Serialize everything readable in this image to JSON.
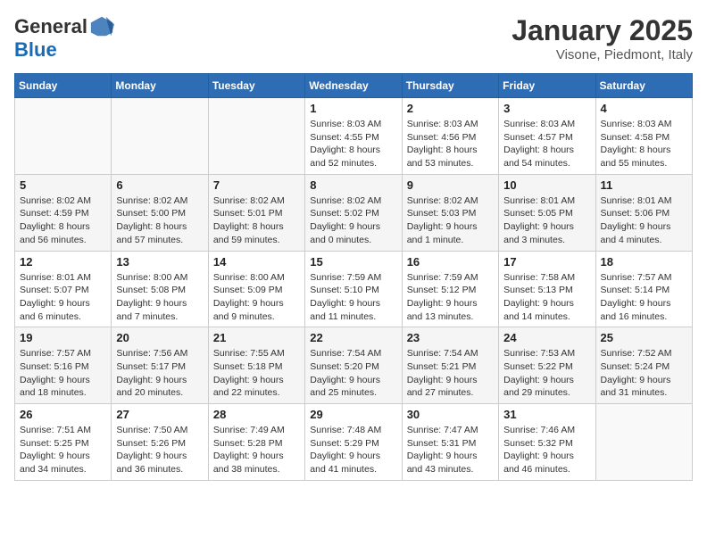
{
  "logo": {
    "general": "General",
    "blue": "Blue"
  },
  "title": "January 2025",
  "subtitle": "Visone, Piedmont, Italy",
  "days_header": [
    "Sunday",
    "Monday",
    "Tuesday",
    "Wednesday",
    "Thursday",
    "Friday",
    "Saturday"
  ],
  "weeks": [
    [
      {
        "day": "",
        "info": ""
      },
      {
        "day": "",
        "info": ""
      },
      {
        "day": "",
        "info": ""
      },
      {
        "day": "1",
        "info": "Sunrise: 8:03 AM\nSunset: 4:55 PM\nDaylight: 8 hours and 52 minutes."
      },
      {
        "day": "2",
        "info": "Sunrise: 8:03 AM\nSunset: 4:56 PM\nDaylight: 8 hours and 53 minutes."
      },
      {
        "day": "3",
        "info": "Sunrise: 8:03 AM\nSunset: 4:57 PM\nDaylight: 8 hours and 54 minutes."
      },
      {
        "day": "4",
        "info": "Sunrise: 8:03 AM\nSunset: 4:58 PM\nDaylight: 8 hours and 55 minutes."
      }
    ],
    [
      {
        "day": "5",
        "info": "Sunrise: 8:02 AM\nSunset: 4:59 PM\nDaylight: 8 hours and 56 minutes."
      },
      {
        "day": "6",
        "info": "Sunrise: 8:02 AM\nSunset: 5:00 PM\nDaylight: 8 hours and 57 minutes."
      },
      {
        "day": "7",
        "info": "Sunrise: 8:02 AM\nSunset: 5:01 PM\nDaylight: 8 hours and 59 minutes."
      },
      {
        "day": "8",
        "info": "Sunrise: 8:02 AM\nSunset: 5:02 PM\nDaylight: 9 hours and 0 minutes."
      },
      {
        "day": "9",
        "info": "Sunrise: 8:02 AM\nSunset: 5:03 PM\nDaylight: 9 hours and 1 minute."
      },
      {
        "day": "10",
        "info": "Sunrise: 8:01 AM\nSunset: 5:05 PM\nDaylight: 9 hours and 3 minutes."
      },
      {
        "day": "11",
        "info": "Sunrise: 8:01 AM\nSunset: 5:06 PM\nDaylight: 9 hours and 4 minutes."
      }
    ],
    [
      {
        "day": "12",
        "info": "Sunrise: 8:01 AM\nSunset: 5:07 PM\nDaylight: 9 hours and 6 minutes."
      },
      {
        "day": "13",
        "info": "Sunrise: 8:00 AM\nSunset: 5:08 PM\nDaylight: 9 hours and 7 minutes."
      },
      {
        "day": "14",
        "info": "Sunrise: 8:00 AM\nSunset: 5:09 PM\nDaylight: 9 hours and 9 minutes."
      },
      {
        "day": "15",
        "info": "Sunrise: 7:59 AM\nSunset: 5:10 PM\nDaylight: 9 hours and 11 minutes."
      },
      {
        "day": "16",
        "info": "Sunrise: 7:59 AM\nSunset: 5:12 PM\nDaylight: 9 hours and 13 minutes."
      },
      {
        "day": "17",
        "info": "Sunrise: 7:58 AM\nSunset: 5:13 PM\nDaylight: 9 hours and 14 minutes."
      },
      {
        "day": "18",
        "info": "Sunrise: 7:57 AM\nSunset: 5:14 PM\nDaylight: 9 hours and 16 minutes."
      }
    ],
    [
      {
        "day": "19",
        "info": "Sunrise: 7:57 AM\nSunset: 5:16 PM\nDaylight: 9 hours and 18 minutes."
      },
      {
        "day": "20",
        "info": "Sunrise: 7:56 AM\nSunset: 5:17 PM\nDaylight: 9 hours and 20 minutes."
      },
      {
        "day": "21",
        "info": "Sunrise: 7:55 AM\nSunset: 5:18 PM\nDaylight: 9 hours and 22 minutes."
      },
      {
        "day": "22",
        "info": "Sunrise: 7:54 AM\nSunset: 5:20 PM\nDaylight: 9 hours and 25 minutes."
      },
      {
        "day": "23",
        "info": "Sunrise: 7:54 AM\nSunset: 5:21 PM\nDaylight: 9 hours and 27 minutes."
      },
      {
        "day": "24",
        "info": "Sunrise: 7:53 AM\nSunset: 5:22 PM\nDaylight: 9 hours and 29 minutes."
      },
      {
        "day": "25",
        "info": "Sunrise: 7:52 AM\nSunset: 5:24 PM\nDaylight: 9 hours and 31 minutes."
      }
    ],
    [
      {
        "day": "26",
        "info": "Sunrise: 7:51 AM\nSunset: 5:25 PM\nDaylight: 9 hours and 34 minutes."
      },
      {
        "day": "27",
        "info": "Sunrise: 7:50 AM\nSunset: 5:26 PM\nDaylight: 9 hours and 36 minutes."
      },
      {
        "day": "28",
        "info": "Sunrise: 7:49 AM\nSunset: 5:28 PM\nDaylight: 9 hours and 38 minutes."
      },
      {
        "day": "29",
        "info": "Sunrise: 7:48 AM\nSunset: 5:29 PM\nDaylight: 9 hours and 41 minutes."
      },
      {
        "day": "30",
        "info": "Sunrise: 7:47 AM\nSunset: 5:31 PM\nDaylight: 9 hours and 43 minutes."
      },
      {
        "day": "31",
        "info": "Sunrise: 7:46 AM\nSunset: 5:32 PM\nDaylight: 9 hours and 46 minutes."
      },
      {
        "day": "",
        "info": ""
      }
    ]
  ]
}
